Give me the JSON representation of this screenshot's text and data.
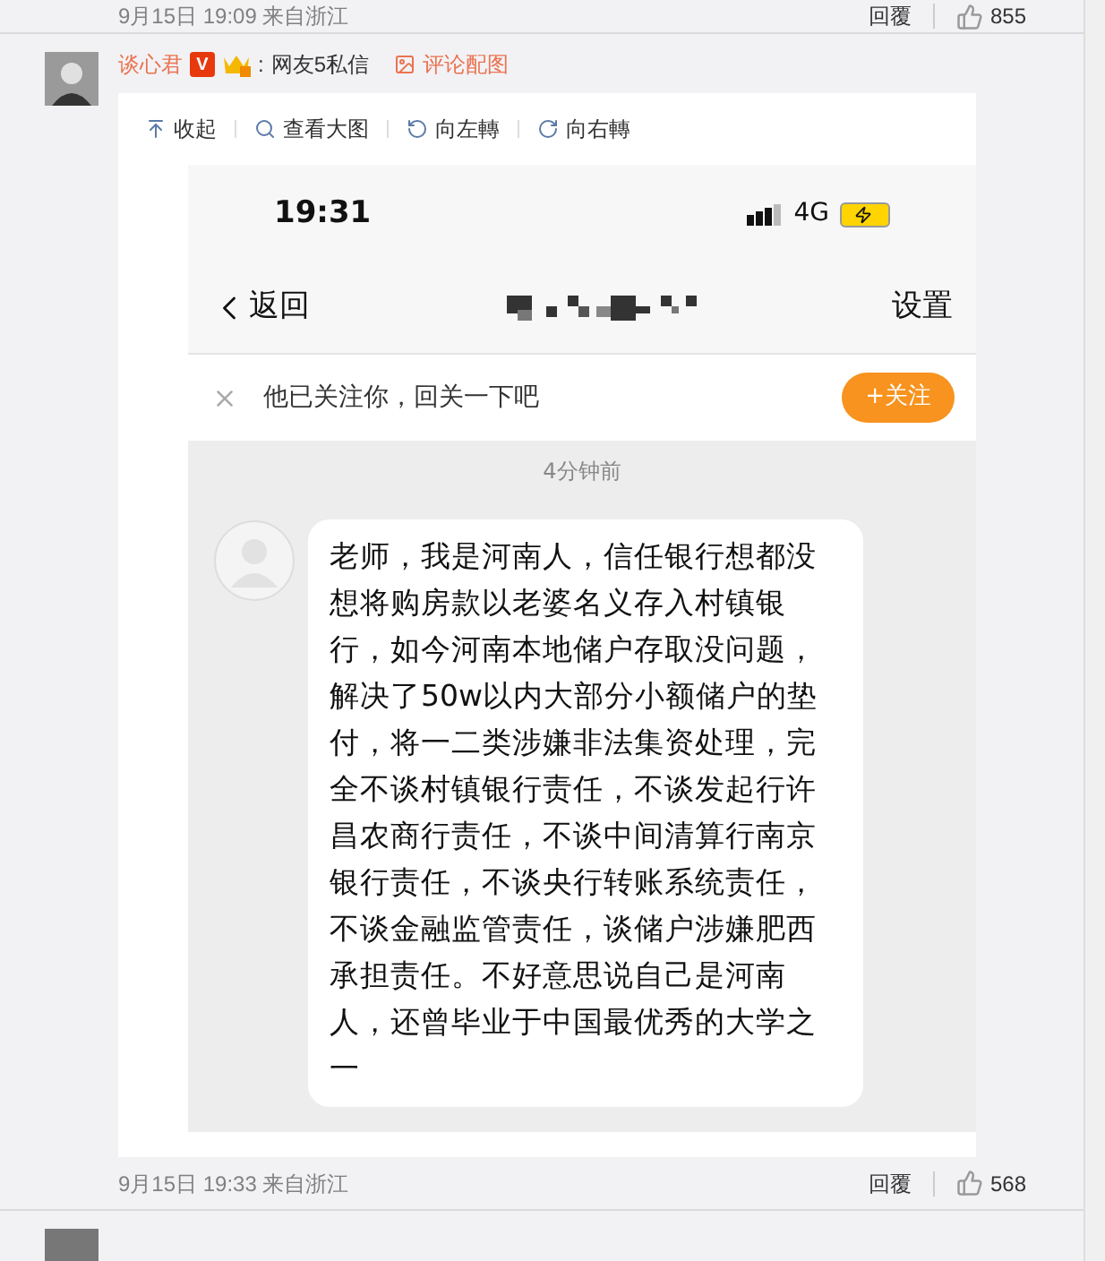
{
  "comments": [
    {
      "kind": "tail",
      "time": "9月15日 19:09 来自浙江",
      "reply": "回覆",
      "likes": "855"
    },
    {
      "kind": "full",
      "author": "谈心君",
      "badge": "V",
      "separator": ":",
      "message_link": "网友5私信",
      "attach_link": "评论配图",
      "toolbar": [
        "收起",
        "查看大图",
        "向左轉",
        "向右轉"
      ],
      "phone": {
        "clock": "19:31",
        "network": "4G",
        "back": "返回",
        "settings": "设置",
        "follow_hint": "他已关注你，回关一下吧",
        "follow_button": "+关注",
        "stamp": "4分钟前",
        "message": "老师，我是河南人，信任银行想都没想将购房款以老婆名义存入村镇银行，如今河南本地储户存取没问题，解决了50w以内大部分小额储户的垫付，将一二类涉嫌非法集资处理，完全不谈村镇银行责任，不谈发起行许昌农商行责任，不谈中间清算行南京银行责任，不谈央行转账系统责任，不谈金融监管责任，谈储户涉嫌肥西承担责任。不好意思说自己是河南人，还曾毕业于中国最优秀的大学之一"
      },
      "time": "9月15日 19:33 来自浙江",
      "reply": "回覆",
      "likes": "568"
    }
  ]
}
